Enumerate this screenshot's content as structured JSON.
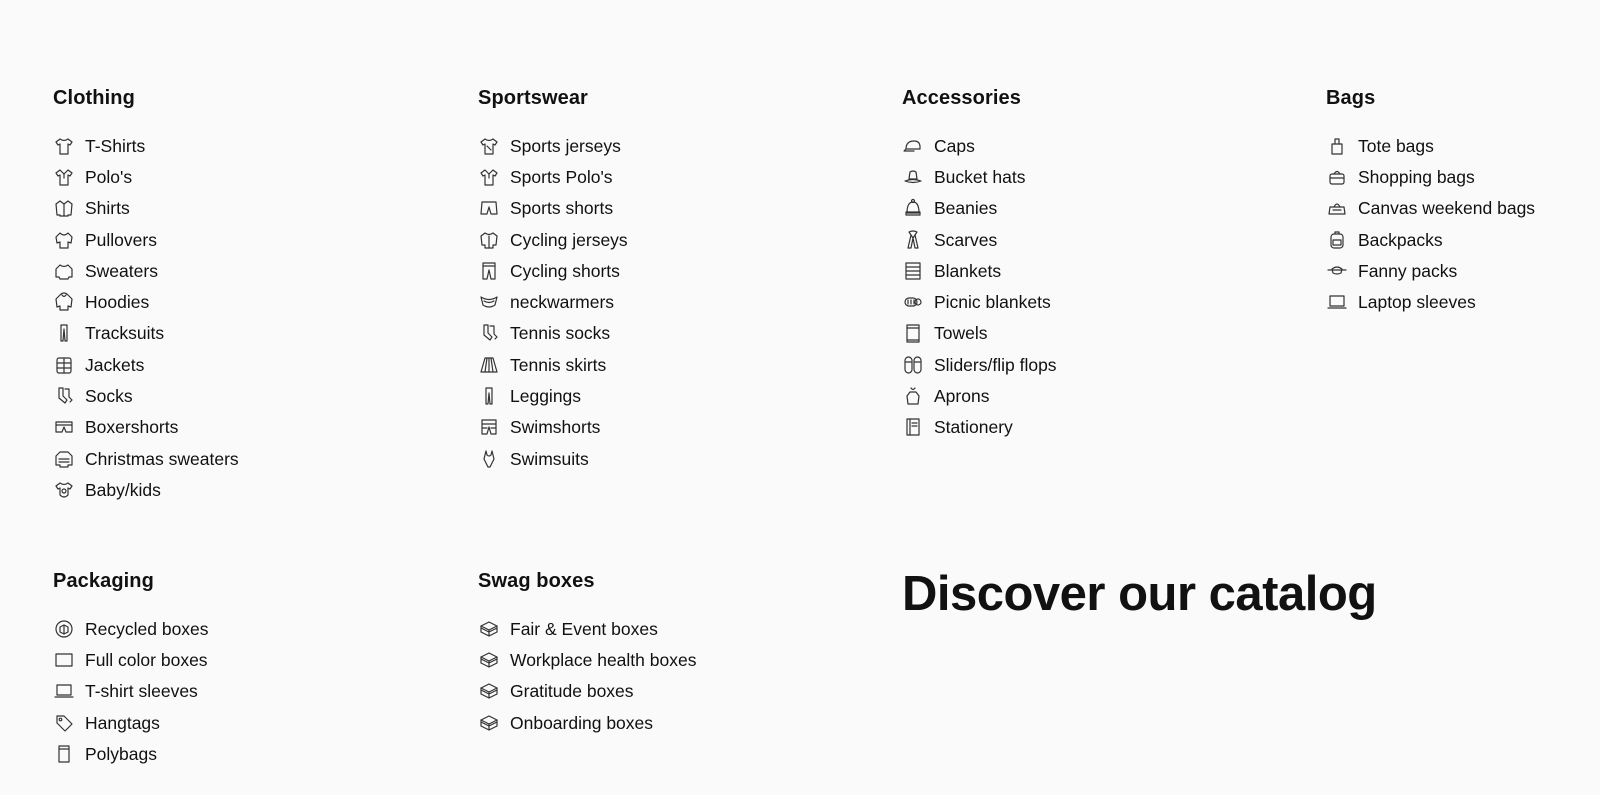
{
  "columns": [
    {
      "title": "Clothing",
      "items": [
        {
          "label": "T-Shirts",
          "icon": "tshirt-icon"
        },
        {
          "label": "Polo's",
          "icon": "polo-icon"
        },
        {
          "label": "Shirts",
          "icon": "shirt-icon"
        },
        {
          "label": "Pullovers",
          "icon": "pullover-icon"
        },
        {
          "label": "Sweaters",
          "icon": "sweater-icon"
        },
        {
          "label": "Hoodies",
          "icon": "hoodie-icon"
        },
        {
          "label": "Tracksuits",
          "icon": "tracksuit-icon"
        },
        {
          "label": "Jackets",
          "icon": "jacket-icon"
        },
        {
          "label": "Socks",
          "icon": "socks-icon"
        },
        {
          "label": "Boxershorts",
          "icon": "boxershorts-icon"
        },
        {
          "label": "Christmas sweaters",
          "icon": "christmas-sweater-icon"
        },
        {
          "label": "Baby/kids",
          "icon": "baby-icon"
        }
      ]
    },
    {
      "title": "Sportswear",
      "items": [
        {
          "label": "Sports jerseys",
          "icon": "jersey-icon"
        },
        {
          "label": "Sports Polo's",
          "icon": "polo-icon"
        },
        {
          "label": "Sports shorts",
          "icon": "shorts-icon"
        },
        {
          "label": "Cycling jerseys",
          "icon": "cycling-jersey-icon"
        },
        {
          "label": "Cycling shorts",
          "icon": "cycling-shorts-icon"
        },
        {
          "label": "neckwarmers",
          "icon": "neckwarmer-icon"
        },
        {
          "label": "Tennis socks",
          "icon": "socks-icon"
        },
        {
          "label": "Tennis skirts",
          "icon": "skirt-icon"
        },
        {
          "label": "Leggings",
          "icon": "leggings-icon"
        },
        {
          "label": "Swimshorts",
          "icon": "swimshorts-icon"
        },
        {
          "label": "Swimsuits",
          "icon": "swimsuit-icon"
        }
      ]
    },
    {
      "title": "Accessories",
      "items": [
        {
          "label": "Caps",
          "icon": "cap-icon"
        },
        {
          "label": "Bucket hats",
          "icon": "bucket-hat-icon"
        },
        {
          "label": "Beanies",
          "icon": "beanie-icon"
        },
        {
          "label": "Scarves",
          "icon": "scarf-icon"
        },
        {
          "label": "Blankets",
          "icon": "blanket-icon"
        },
        {
          "label": "Picnic blankets",
          "icon": "picnic-blanket-icon"
        },
        {
          "label": "Towels",
          "icon": "towel-icon"
        },
        {
          "label": "Sliders/flip flops",
          "icon": "flip-flops-icon"
        },
        {
          "label": "Aprons",
          "icon": "apron-icon"
        },
        {
          "label": "Stationery",
          "icon": "notebook-icon"
        }
      ]
    },
    {
      "title": "Bags",
      "items": [
        {
          "label": "Tote bags",
          "icon": "tote-bag-icon"
        },
        {
          "label": "Shopping bags",
          "icon": "shopping-bag-icon"
        },
        {
          "label": "Canvas weekend bags",
          "icon": "weekend-bag-icon"
        },
        {
          "label": "Backpacks",
          "icon": "backpack-icon"
        },
        {
          "label": "Fanny packs",
          "icon": "fanny-pack-icon"
        },
        {
          "label": "Laptop sleeves",
          "icon": "laptop-icon"
        }
      ]
    },
    {
      "title": "Packaging",
      "items": [
        {
          "label": "Recycled boxes",
          "icon": "recycle-box-icon"
        },
        {
          "label": "Full color boxes",
          "icon": "box-rect-icon"
        },
        {
          "label": "T-shirt sleeves",
          "icon": "laptop-icon"
        },
        {
          "label": "Hangtags",
          "icon": "tag-icon"
        },
        {
          "label": "Polybags",
          "icon": "polybag-icon"
        }
      ]
    },
    {
      "title": "Swag boxes",
      "items": [
        {
          "label": "Fair & Event boxes",
          "icon": "open-box-icon"
        },
        {
          "label": "Workplace health boxes",
          "icon": "open-box-icon"
        },
        {
          "label": "Gratitude boxes",
          "icon": "open-box-icon"
        },
        {
          "label": "Onboarding boxes",
          "icon": "open-box-icon"
        }
      ]
    }
  ],
  "discover": {
    "heading": "Discover our catalog"
  }
}
